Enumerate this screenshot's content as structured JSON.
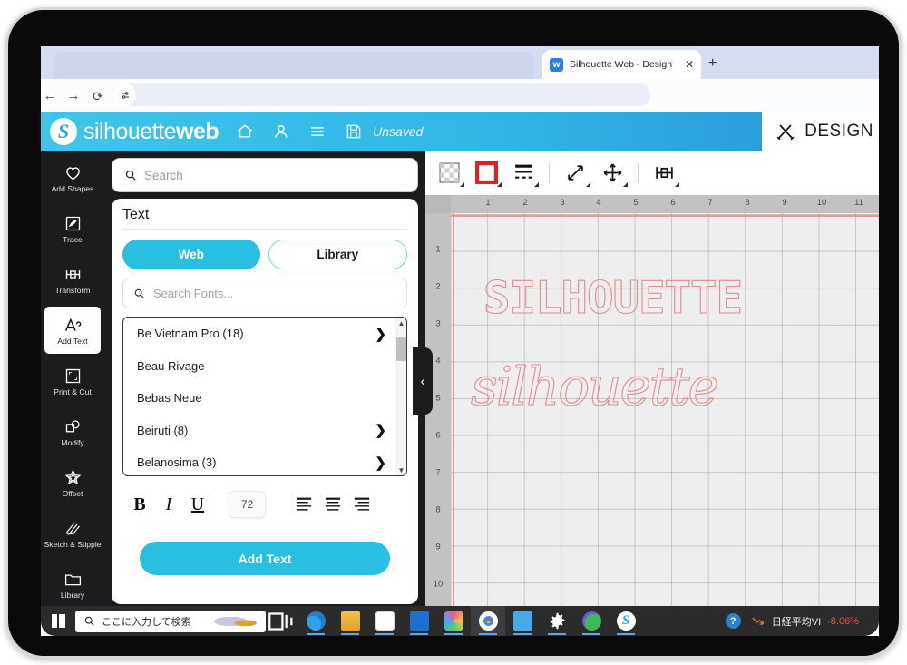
{
  "browser": {
    "tab": {
      "title": "Silhouette Web - Design",
      "favicon": "w",
      "close_icon": "✕"
    },
    "new_tab_icon": "+",
    "nav": {
      "back": "←",
      "forward": "→",
      "reload": "⟳"
    },
    "address_value": "",
    "address_placeholder": ""
  },
  "app_header": {
    "logo_mark": "S",
    "logo_text_light": "silhouette",
    "logo_text_bold": "web",
    "icons": [
      "home-icon",
      "account-icon",
      "menu-icon",
      "save-icon"
    ],
    "save_status": "Unsaved",
    "mode_label": "DESIGN"
  },
  "tool_rail": {
    "items": [
      {
        "label": "Add Shapes",
        "icon": "heart-icon",
        "active": false
      },
      {
        "label": "Trace",
        "icon": "trace-icon",
        "active": false
      },
      {
        "label": "Transform",
        "icon": "transform-icon",
        "active": false
      },
      {
        "label": "Add Text",
        "icon": "add-text-icon",
        "active": true
      },
      {
        "label": "Print & Cut",
        "icon": "print-cut-icon",
        "active": false
      },
      {
        "label": "Modify",
        "icon": "modify-icon",
        "active": false
      },
      {
        "label": "Offset",
        "icon": "offset-star-icon",
        "active": false
      },
      {
        "label": "Sketch & Stipple",
        "icon": "sketch-stipple-icon",
        "active": false
      },
      {
        "label": "Library",
        "icon": "folder-icon",
        "active": false
      }
    ]
  },
  "panel": {
    "search_placeholder": "Search",
    "search_value": "",
    "title": "Text",
    "source_tabs": [
      {
        "label": "Web",
        "selected": true
      },
      {
        "label": "Library",
        "selected": false
      }
    ],
    "font_search_placeholder": "Search Fonts...",
    "font_search_value": "",
    "fonts": [
      {
        "name": "Be Vietnam Pro (18)",
        "has_children": true
      },
      {
        "name": "Beau Rivage",
        "has_children": false
      },
      {
        "name": "Bebas Neue",
        "has_children": false
      },
      {
        "name": "Beiruti (8)",
        "has_children": true
      },
      {
        "name": "Belanosima (3)",
        "has_children": true
      }
    ],
    "chevron": "❯",
    "format": {
      "bold": "B",
      "italic": "I",
      "underline": "U",
      "font_size": "72",
      "align_left": "align-left-icon",
      "align_center": "align-center-icon",
      "align_right": "align-right-icon"
    },
    "add_text_label": "Add Text",
    "collapse_icon": "‹"
  },
  "canvas": {
    "toolbar": [
      "fill-color-icon",
      "line-color-icon",
      "line-style-icon",
      "scale-icon",
      "move-icon",
      "transform-icon"
    ],
    "accent_outline_color": "#e08b8b",
    "ruler_h": [
      "1",
      "2",
      "3",
      "4",
      "5",
      "6",
      "7",
      "8",
      "9",
      "10",
      "11"
    ],
    "ruler_v": [
      "1",
      "2",
      "3",
      "4",
      "5",
      "6",
      "7",
      "8",
      "9",
      "10"
    ],
    "artwork": [
      {
        "text": "SILHOUETTE",
        "style": "block-outline"
      },
      {
        "text": "silhouette",
        "style": "script-outline"
      }
    ]
  },
  "taskbar": {
    "start_icon": "windows-logo-icon",
    "search_placeholder": "ここに入力して検索",
    "task_view_icon": "task-view-icon",
    "apps": [
      "edge-icon",
      "file-explorer-icon",
      "microsoft-store-icon",
      "mail-icon",
      "photos-icon",
      "chrome-icon",
      "contacts-icon",
      "settings-icon",
      "security-icon",
      "silhouette-icon"
    ],
    "help_icon": "?",
    "stock_name": "日経平均VI",
    "stock_change": "-8.06%",
    "stock_change_color": "#e2574c"
  }
}
